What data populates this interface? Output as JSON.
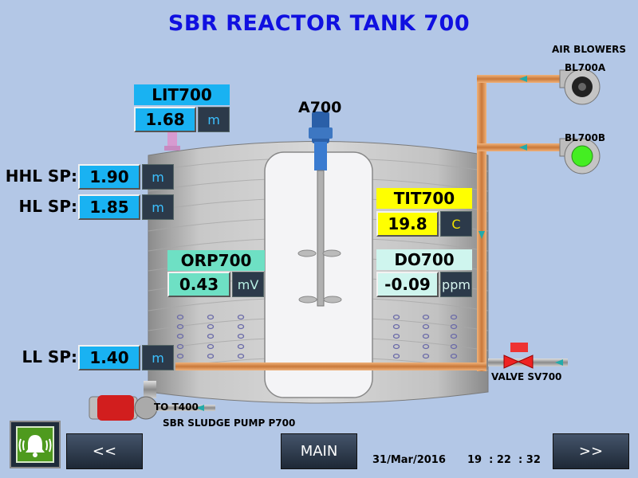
{
  "title": "SBR REACTOR TANK 700",
  "air_blowers": {
    "label": "AIR BLOWERS",
    "blower_a": "BL700A",
    "blower_b": "BL700B"
  },
  "agitator": {
    "label": "A700"
  },
  "level": {
    "tag": "LIT700",
    "value": "1.68",
    "unit": "m"
  },
  "hhl_sp": {
    "label": "HHL SP:",
    "value": "1.90",
    "unit": "m"
  },
  "hl_sp": {
    "label": "HL SP:",
    "value": "1.85",
    "unit": "m"
  },
  "ll_sp": {
    "label": "LL SP:",
    "value": "1.40",
    "unit": "m"
  },
  "temperature": {
    "tag": "TIT700",
    "value": "19.8",
    "unit": "C"
  },
  "orp": {
    "tag": "ORP700",
    "value": "0.43",
    "unit": "mV"
  },
  "do": {
    "tag": "DO700",
    "value": "-0.09",
    "unit": "ppm"
  },
  "valve": {
    "label": "VALVE SV700"
  },
  "pump": {
    "label": "SBR SLUDGE PUMP P700",
    "destination": "TO T400"
  },
  "nav": {
    "prev": "<<",
    "main": "MAIN",
    "next": ">>"
  },
  "footer": {
    "date": "31/Mar/2016",
    "hour": "19",
    "minute": "22",
    "second": "32"
  },
  "colors": {
    "title": "#1010e0",
    "tag_cyan": "#19b2f2",
    "tag_yellow": "#ffff00",
    "tag_mint": "#6ee0c4",
    "pipe": "#d98a4a",
    "blower_b_status": "#44ee22"
  },
  "icons": {
    "alarm": "alarm-bell-icon"
  }
}
